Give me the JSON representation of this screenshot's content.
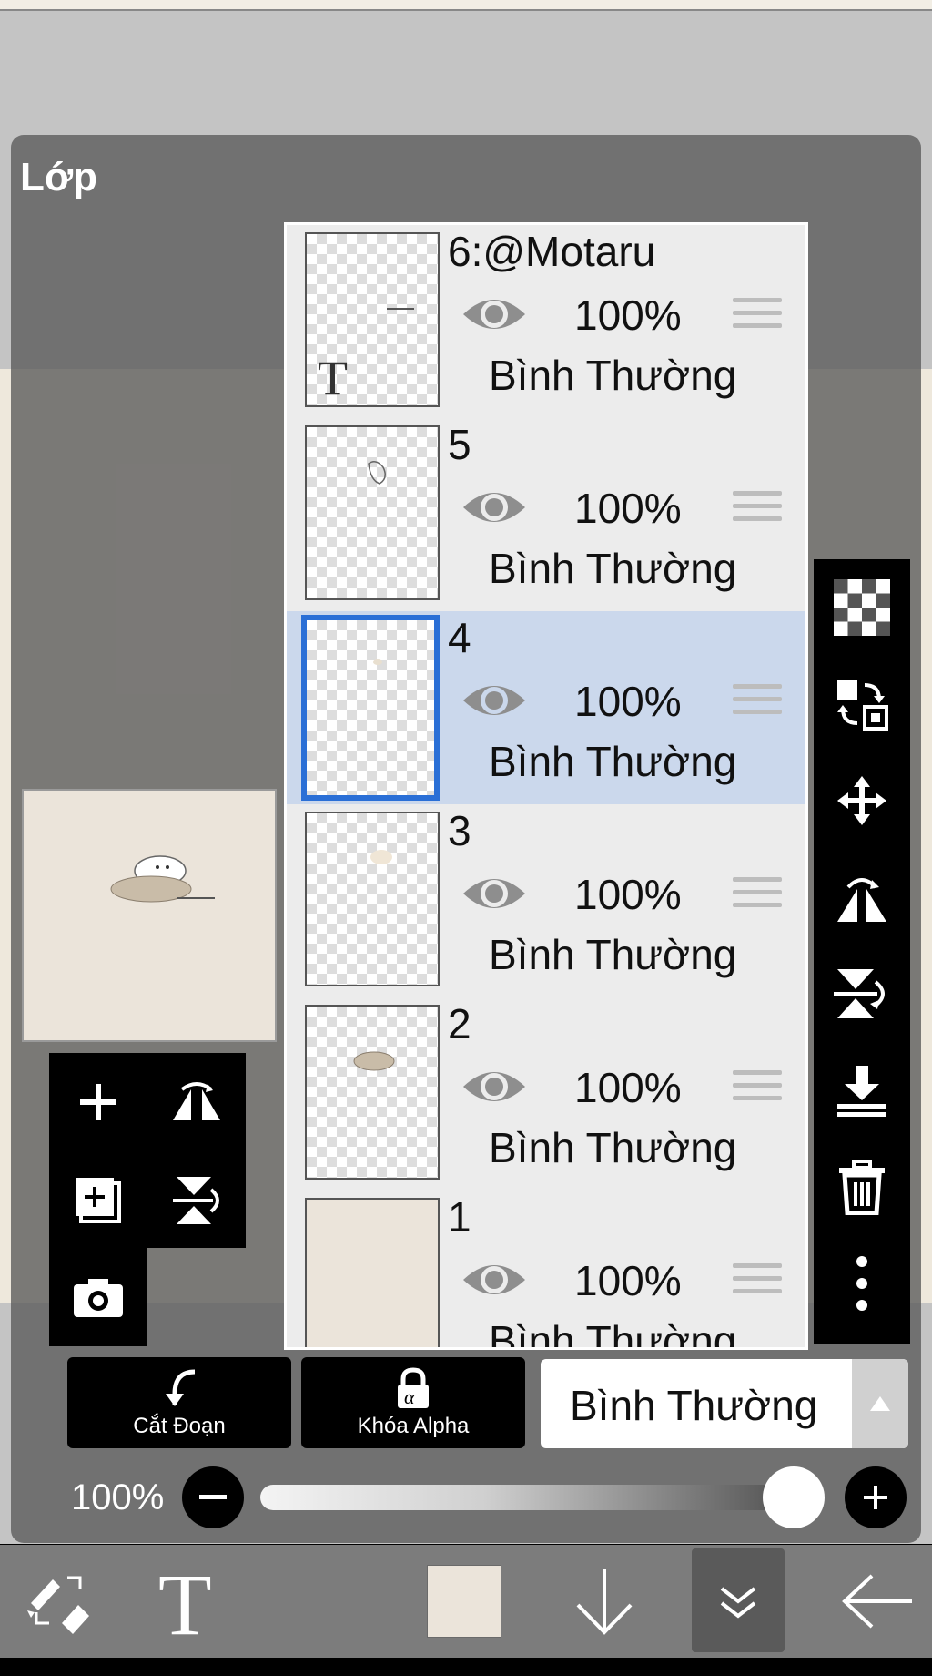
{
  "panel": {
    "title": "Lớp"
  },
  "layers": [
    {
      "name": "6:@Motaru",
      "opacity": "100%",
      "blend_mode": "Bình Thường",
      "type": "text",
      "selected": false
    },
    {
      "name": "5",
      "opacity": "100%",
      "blend_mode": "Bình Thường",
      "type": "raster",
      "selected": false
    },
    {
      "name": "4",
      "opacity": "100%",
      "blend_mode": "Bình Thường",
      "type": "raster",
      "selected": true
    },
    {
      "name": "3",
      "opacity": "100%",
      "blend_mode": "Bình Thường",
      "type": "raster",
      "selected": false
    },
    {
      "name": "2",
      "opacity": "100%",
      "blend_mode": "Bình Thường",
      "type": "raster",
      "selected": false
    },
    {
      "name": "1",
      "opacity": "100%",
      "blend_mode": "Bình Thường",
      "type": "fill",
      "selected": false
    }
  ],
  "left_tools": [
    "add-layer-icon",
    "flip-horizontal-icon",
    "duplicate-layer-icon",
    "flip-vertical-icon",
    "camera-icon"
  ],
  "right_tools": [
    "transparency-icon",
    "swap-icon",
    "move-icon",
    "flip-horizontal-icon",
    "flip-vertical-icon",
    "merge-down-icon",
    "trash-icon",
    "more-icon"
  ],
  "controls": {
    "clip_label": "Cắt Đoạn",
    "alpha_lock_label": "Khóa Alpha",
    "blend_mode_value": "Bình Thường",
    "opacity_label": "100%",
    "opacity_value": 1.0
  },
  "bottom_bar": [
    "swap-brush-icon",
    "text-tool-icon",
    "color-swatch",
    "arrow-down-icon",
    "collapse-icon",
    "back-icon"
  ],
  "colors": {
    "selected_row": "#cbd8ec",
    "selected_border": "#2a6fd6",
    "canvas": "#ebe4da"
  }
}
